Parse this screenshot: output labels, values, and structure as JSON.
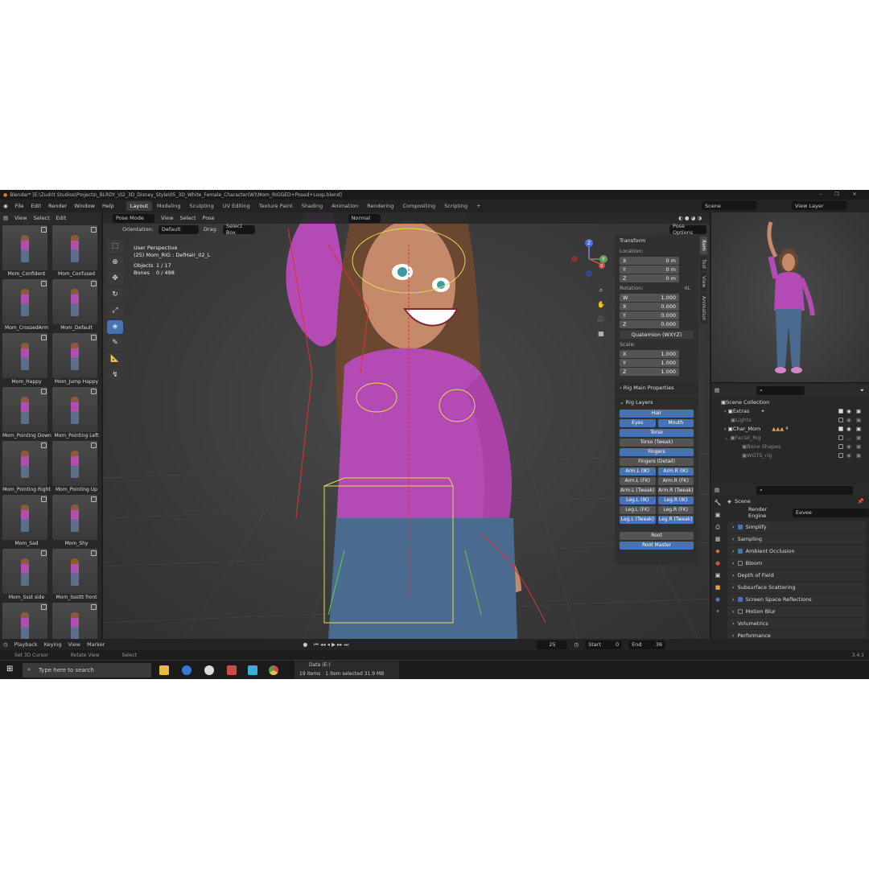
{
  "window": {
    "title": "Blender* [E:\\Zudrit Studios\\Projects\\_BLRDY_\\02_3D_Disney_Style\\05_3D_White_Female_Character(W)\\Mom_RIGGED+Posed+Loop.blend]"
  },
  "topbar": {
    "menus": [
      "File",
      "Edit",
      "Render",
      "Window",
      "Help"
    ],
    "workspaces": [
      "Layout",
      "Modeling",
      "Sculpting",
      "UV Editing",
      "Texture Paint",
      "Shading",
      "Animation",
      "Rendering",
      "Compositing",
      "Scripting"
    ],
    "active_workspace": "Layout",
    "add_tab": "+",
    "scene": "Scene",
    "view_layer": "View Layer"
  },
  "left_panel": {
    "menus": [
      "View",
      "Select",
      "Edit"
    ],
    "thumbnails": [
      "Mom_Confident",
      "Mom_Confused",
      "Mom_CrossedArm",
      "Mom_Default",
      "Mom_Happy",
      "Mom_Jump Happy",
      "Mom_Pointing Down",
      "Mom_Pointing Left",
      "Mom_Pointing Right",
      "Mom_Pointing Up",
      "Mom_Sad",
      "Mom_Shy",
      "Mom_Ssst side",
      "Mom_Sssttt front",
      "",
      ""
    ]
  },
  "viewport": {
    "mode": "Pose Mode",
    "menus": [
      "View",
      "Select",
      "Pose"
    ],
    "shading_mode": "Normal",
    "orientation_label": "Orientation:",
    "orientation": "Default",
    "drag_label": "Drag:",
    "drag": "Select Box",
    "pose_options": "Pose Options",
    "overlay": {
      "view": "User Perspective",
      "object": "(25) Mom_RIG : DefHair_02_L",
      "objects_label": "Objects",
      "objects": "1 / 17",
      "bones_label": "Bones",
      "bones": "0 / 498"
    },
    "gizmo": {
      "x": "X",
      "y": "Y",
      "z": "Z"
    }
  },
  "npanel": {
    "tabs": [
      "Item",
      "Tool",
      "View",
      "Animation"
    ],
    "transform": "Transform",
    "location_label": "Location:",
    "location": [
      {
        "axis": "X",
        "value": "0 m"
      },
      {
        "axis": "Y",
        "value": "0 m"
      },
      {
        "axis": "Z",
        "value": "0 m"
      }
    ],
    "rotation_label": "Rotation:",
    "rotation_mode_short": "4L",
    "rotation": [
      {
        "axis": "W",
        "value": "1.000"
      },
      {
        "axis": "X",
        "value": "0.000"
      },
      {
        "axis": "Y",
        "value": "0.000"
      },
      {
        "axis": "Z",
        "value": "0.000"
      }
    ],
    "rotation_mode": "Quaternion (WXYZ)",
    "scale_label": "Scale:",
    "scale": [
      {
        "axis": "X",
        "value": "1.000"
      },
      {
        "axis": "Y",
        "value": "1.000"
      },
      {
        "axis": "Z",
        "value": "1.000"
      }
    ],
    "rig_main": "Rig Main Properties",
    "rig_layers": "Rig Layers",
    "layers": {
      "hair": "Hair",
      "eyes": "Eyes",
      "mouth": "Mouth",
      "torso": "Torso",
      "torso_tweak": "Torso (Tweak)",
      "fingers": "Fingers",
      "fingers_detail": "Fingers (Detail)",
      "arm_l_ik": "Arm.L (IK)",
      "arm_r_ik": "Arm.R (IK)",
      "arm_l_fk": "Arm.L (FK)",
      "arm_r_fk": "Arm.R (FK)",
      "arm_l_tweak": "Arm.L (Tweak)",
      "arm_r_tweak": "Arm.R (Tweak)",
      "leg_l_ik": "Leg.L (IK)",
      "leg_r_ik": "Leg.R (IK)",
      "leg_l_fk": "Leg.L (FK)",
      "leg_r_fk": "Leg.R (FK)",
      "leg_l_tweak": "Leg.L (Tweak)",
      "leg_r_tweak": "Leg.R (Tweak)",
      "root": "Root",
      "root_master": "Root Master"
    }
  },
  "outliner": {
    "items": [
      {
        "label": "Scene Collection",
        "indent": 0
      },
      {
        "label": "Extras",
        "indent": 1
      },
      {
        "label": "Lights",
        "indent": 1
      },
      {
        "label": "Char_Mom",
        "indent": 1
      },
      {
        "label": "Facial_Rig",
        "indent": 1
      },
      {
        "label": "Bone Shapes",
        "indent": 2
      },
      {
        "label": "WGTS_rig",
        "indent": 2
      }
    ],
    "badge": "4"
  },
  "properties": {
    "scene": "Scene",
    "render_engine_label": "Render Engine",
    "render_engine": "Eevee",
    "sections": [
      {
        "label": "Simplify",
        "checkbox": true,
        "checked": true
      },
      {
        "label": "Sampling",
        "checkbox": false
      },
      {
        "label": "Ambient Occlusion",
        "checkbox": true,
        "checked": true
      },
      {
        "label": "Bloom",
        "checkbox": true,
        "checked": false
      },
      {
        "label": "Depth of Field",
        "checkbox": false
      },
      {
        "label": "Subsurface Scattering",
        "checkbox": false
      },
      {
        "label": "Screen Space Reflections",
        "checkbox": true,
        "checked": true
      },
      {
        "label": "Motion Blur",
        "checkbox": true,
        "checked": false
      },
      {
        "label": "Volumetrics",
        "checkbox": false
      },
      {
        "label": "Performance",
        "checkbox": false
      }
    ]
  },
  "timeline": {
    "menus": [
      "Playback",
      "Keying",
      "View",
      "Marker"
    ],
    "frame": "25",
    "start_label": "Start",
    "start": "0",
    "end_label": "End",
    "end": "36"
  },
  "status": {
    "set_cursor": "Set 3D Cursor",
    "rotate": "Rotate View",
    "select": "Select",
    "version": "3.4.1"
  },
  "taskbar": {
    "search_placeholder": "Type here to search",
    "explorer_title": "Data (E:)",
    "items": "19 items",
    "selected": "1 item selected  31.9 MB"
  },
  "colors": {
    "accent": "#4772b3",
    "bg": "#1d1d1d",
    "panel": "#282828"
  }
}
